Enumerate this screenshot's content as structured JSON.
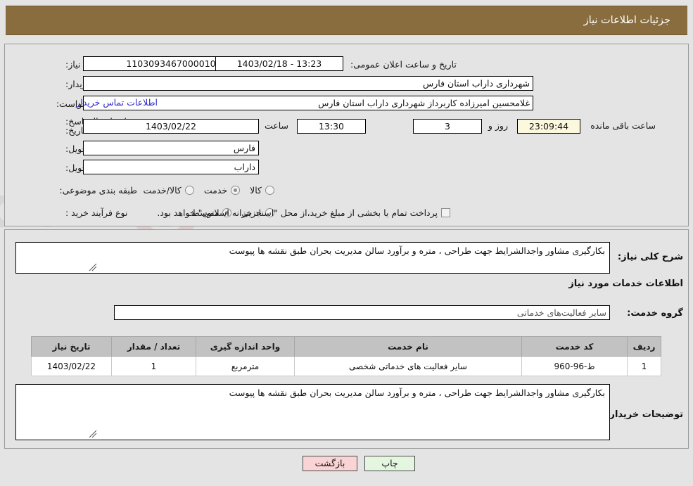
{
  "header": {
    "title": "جزئیات اطلاعات نیاز"
  },
  "form": {
    "need_number_label": "شماره نیاز:",
    "need_number_value": "1103093467000010",
    "announce_label": "تاریخ و ساعت اعلان عمومی:",
    "announce_value": "13:23 - 1403/02/18",
    "buyer_org_label": "نام دستگاه خریدار:",
    "buyer_org_value": "شهرداری داراب استان فارس",
    "requester_label": "ایجاد کننده درخواست:",
    "requester_value": "غلامحسین امیرزاده کاربرداز شهرداری داراب استان فارس",
    "contact_link": "اطلاعات تماس خریدار",
    "deadline_label": "مهلت ارسال پاسخ: تا تاریخ:",
    "deadline_date": "1403/02/22",
    "hour_label": "ساعت",
    "deadline_time": "13:30",
    "days_remaining": "3",
    "days_label": "روز و",
    "countdown": "23:09:44",
    "remaining_label": "ساعت باقی مانده",
    "province_label": "استان محل تحویل:",
    "province_value": "فارس",
    "city_label": "شهر محل تحویل:",
    "city_value": "داراب",
    "category_label": "طبقه بندی موضوعی:",
    "category_options": [
      {
        "label": "کالا",
        "selected": false
      },
      {
        "label": "خدمت",
        "selected": true
      },
      {
        "label": "کالا/خدمت",
        "selected": false
      }
    ],
    "process_label": "نوع فرآیند خرید :",
    "process_options": [
      {
        "label": "جزیی",
        "selected": false
      },
      {
        "label": "متوسط",
        "selected": true
      }
    ],
    "treasury_checkbox_checked": false,
    "treasury_text": "پرداخت تمام یا بخشی از مبلغ خرید،از محل \"اسناد خزانه اسلامی\" خواهد بود."
  },
  "need_description": {
    "label": "شرح کلی نیاز:",
    "value": "بکارگیری مشاور واجدالشرایط جهت طراحی ، متره و برآورد سالن مدیریت بحران  طبق نقشه ها پیوست"
  },
  "services_section": {
    "title": "اطلاعات خدمات مورد نیاز",
    "group_label": "گروه خدمت:",
    "group_value": "سایر فعالیت‌های خدماتی"
  },
  "table": {
    "headers": [
      "ردیف",
      "کد خدمت",
      "نام خدمت",
      "واحد اندازه گیری",
      "تعداد / مقدار",
      "تاریخ نیاز"
    ],
    "rows": [
      {
        "row": "1",
        "code": "ط-96-960",
        "name": "سایر فعالیت های خدماتی شخصی",
        "unit": "مترمربع",
        "qty": "1",
        "date": "1403/02/22"
      }
    ]
  },
  "buyer_notes": {
    "label": "توضیحات خریدار:",
    "value": "بکارگیری مشاور واجدالشرایط جهت طراحی ، متره و برآورد سالن مدیریت بحران  طبق نقشه ها پیوست"
  },
  "buttons": {
    "back": "بازگشت",
    "print": "چاپ"
  },
  "watermark": {
    "text": "AnaTender.net"
  },
  "colors": {
    "header_bg": "#8a6d3f",
    "page_bg": "#e4e4e4",
    "link": "#2a2aca",
    "back_btn": "#fad4d4",
    "print_btn": "#e4f6e0",
    "countdown_bg": "#fbf8dd",
    "table_header_bg": "#c2c2c2"
  }
}
